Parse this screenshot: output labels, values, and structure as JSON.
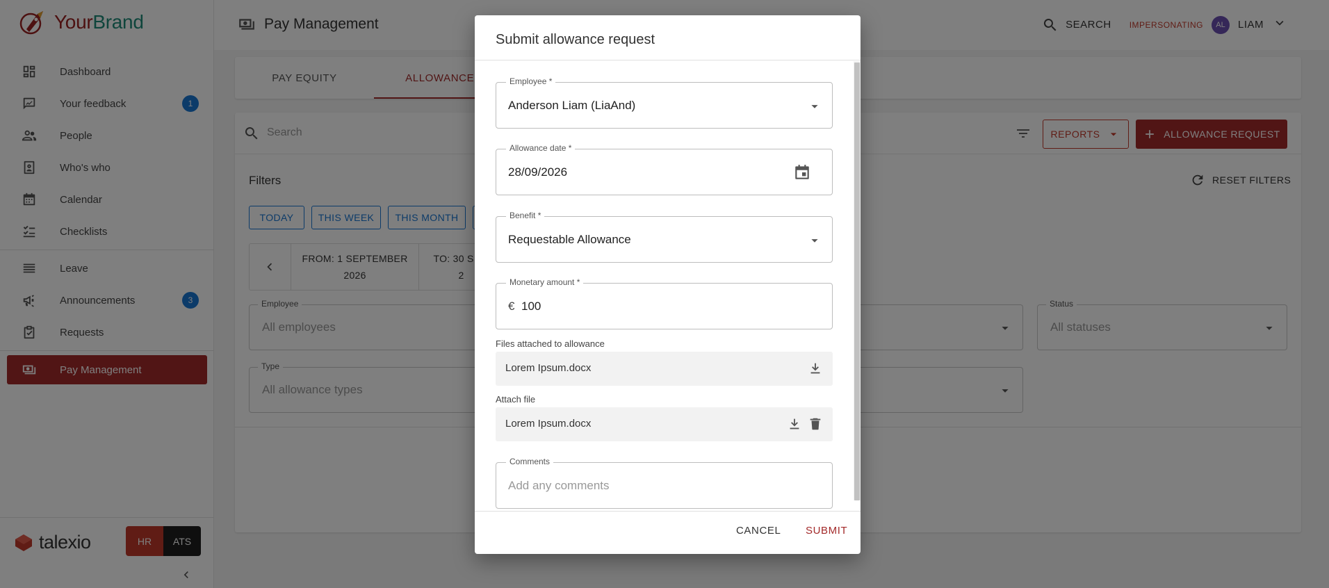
{
  "brand": {
    "name_part1": "Your",
    "name_part2": "Brand",
    "color_primary": "#9b2222",
    "color_secondary": "#1e8a78"
  },
  "sidebar": {
    "items": [
      {
        "label": "Dashboard",
        "icon": "dashboard-icon"
      },
      {
        "label": "Your feedback",
        "icon": "feedback-icon",
        "badge": "1"
      },
      {
        "label": "People",
        "icon": "people-icon"
      },
      {
        "label": "Who's who",
        "icon": "badge-icon"
      },
      {
        "label": "Calendar",
        "icon": "calendar-icon"
      },
      {
        "label": "Checklists",
        "icon": "checklist-icon"
      },
      {
        "label": "Leave",
        "icon": "leave-icon"
      },
      {
        "label": "Announcements",
        "icon": "megaphone-icon",
        "badge": "3"
      },
      {
        "label": "Requests",
        "icon": "requests-icon"
      },
      {
        "label": "Pay Management",
        "icon": "payments-icon",
        "active": true
      }
    ],
    "footer": {
      "product": "talexio",
      "toggle_hr": "HR",
      "toggle_ats": "ATS"
    }
  },
  "topbar": {
    "title": "Pay Management",
    "search_label": "SEARCH",
    "impersonating_label": "IMPERSONATING",
    "avatar_initials": "AL",
    "user_name": "LIAM"
  },
  "tabs": [
    {
      "label": "PAY EQUITY"
    },
    {
      "label": "ALLOWANCES",
      "active": true
    }
  ],
  "main": {
    "search_placeholder": "Search",
    "reports_label": "REPORTS",
    "allowance_request_label": "ALLOWANCE REQUEST",
    "filters_title": "Filters",
    "reset_filters_label": "RESET FILTERS",
    "quick_filters": [
      "TODAY",
      "THIS WEEK",
      "THIS MONTH"
    ],
    "date_from_line1": "FROM: 1 SEPTEMBER",
    "date_from_line2": "2026",
    "date_to_line1": "TO: 30 S",
    "date_to_line2": "2",
    "fields": {
      "employee": {
        "label": "Employee",
        "value": "All employees"
      },
      "status": {
        "label": "Status",
        "value": "All statuses"
      },
      "type": {
        "label": "Type",
        "value": "All allowance types"
      }
    }
  },
  "dialog": {
    "title": "Submit allowance request",
    "employee": {
      "label": "Employee *",
      "value": "Anderson Liam (LiaAnd)"
    },
    "allowance_date": {
      "label": "Allowance date *",
      "value": "28/09/2026"
    },
    "benefit": {
      "label": "Benefit *",
      "value": "Requestable Allowance"
    },
    "monetary_amount": {
      "label": "Monetary amount *",
      "currency": "€",
      "value": "100"
    },
    "files_attached_label": "Files attached to allowance",
    "files_attached": [
      {
        "name": "Lorem Ipsum.docx"
      }
    ],
    "attach_file_label": "Attach file",
    "attach_files": [
      {
        "name": "Lorem Ipsum.docx"
      }
    ],
    "comments": {
      "label": "Comments",
      "placeholder": "Add any comments"
    },
    "cancel_label": "CANCEL",
    "submit_label": "SUBMIT"
  }
}
